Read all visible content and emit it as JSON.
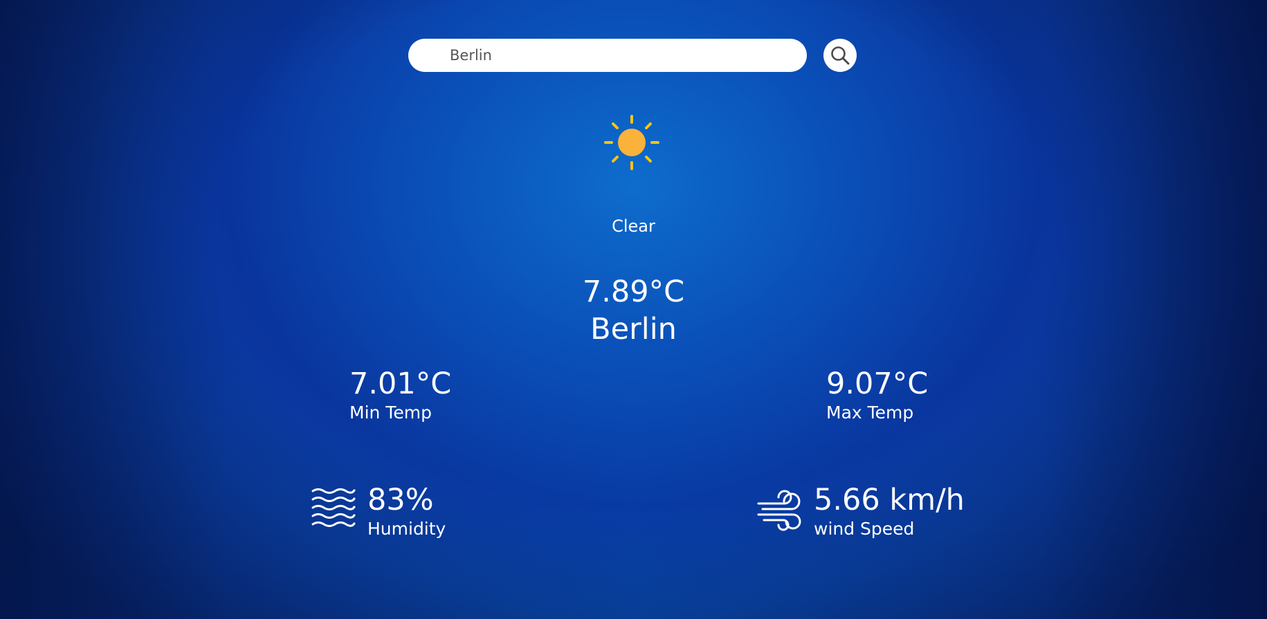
{
  "search": {
    "value": "Berlin",
    "button_icon": "search-icon"
  },
  "weather": {
    "icon": "sun-icon",
    "condition": "Clear",
    "temperature": "7.89°C",
    "city": "Berlin"
  },
  "min_temp": {
    "value": "7.01°C",
    "label": "Min Temp"
  },
  "max_temp": {
    "value": "9.07°C",
    "label": "Max Temp"
  },
  "humidity": {
    "icon": "humidity-waves-icon",
    "value": "83%",
    "label": "Humidity"
  },
  "wind": {
    "icon": "wind-icon",
    "value": "5.66 km/h",
    "label": "wind Speed"
  },
  "colors": {
    "sun_core": "#FBB23A",
    "sun_rays": "#F5C518",
    "text": "#FFFFFF"
  }
}
